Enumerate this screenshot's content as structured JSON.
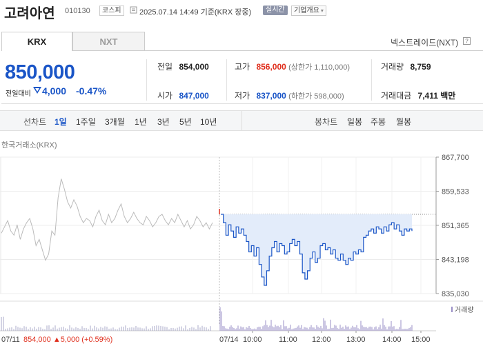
{
  "header": {
    "stock_name": "고려아연",
    "stock_code": "010130",
    "market": "코스피",
    "datetime": "2025.07.14 14:49 기준(KRX 장중)",
    "realtime": "실시간",
    "company_info": "기업개요"
  },
  "tabs": {
    "krx": "KRX",
    "nxt": "NXT",
    "nextrade": "넥스트레이드(NXT)",
    "help": "?"
  },
  "price": {
    "current": "850,000",
    "change_label": "전일대비",
    "change": "4,000",
    "change_pct": "-0.47%"
  },
  "stats": {
    "prev_close_label": "전일",
    "prev_close": "854,000",
    "high_label": "고가",
    "high": "856,000",
    "upper_limit": "(상한가 1,110,000)",
    "volume_label": "거래량",
    "volume": "8,759",
    "open_label": "시가",
    "open": "847,000",
    "low_label": "저가",
    "low": "837,000",
    "lower_limit": "(하한가 598,000)",
    "amount_label": "거래대금",
    "amount": "7,411",
    "amount_unit": "백만"
  },
  "periods": {
    "line_label": "선차트",
    "line_items": [
      "1일",
      "1주일",
      "3개월",
      "1년",
      "3년",
      "5년",
      "10년"
    ],
    "active": "1일",
    "candle_label": "봉차트",
    "candle_items": [
      "일봉",
      "주봉",
      "월봉"
    ]
  },
  "exchange_label": "한국거래소(KRX)",
  "colors": {
    "up": "#e0301e",
    "down": "#1a55c7",
    "area": "#e3ecfa",
    "prev_line": "#bbbbbb"
  },
  "chart_data": {
    "type": "line",
    "y_ticks": [
      "867,700",
      "859,533",
      "851,365",
      "843,198",
      "835,030"
    ],
    "ylim": [
      835030,
      867700
    ],
    "x_ticks": [
      "07/11",
      "07/14",
      "10:00",
      "11:00",
      "12:00",
      "13:00",
      "14:00",
      "15:00"
    ],
    "prev_close": 854000,
    "prev_day_footer": {
      "date": "07/11",
      "price": "854,000",
      "change": "▲5,000",
      "pct": "(+0.59%)"
    },
    "volume_legend": "거래량",
    "series": [
      {
        "values": [
          849500,
          851000,
          852500,
          850000,
          849000,
          851500,
          848000,
          850500,
          852000,
          853000,
          850500,
          846500,
          848000,
          845500,
          843000,
          844500,
          850000,
          849000,
          858000,
          862500,
          860000,
          857000,
          855500,
          857500,
          856000,
          853500,
          852000,
          853000,
          852500,
          851000,
          853500,
          855000,
          852500,
          851500,
          854000,
          852000,
          853000,
          855000,
          856500,
          853500,
          852000,
          853000,
          854500,
          853000,
          852000,
          851500,
          853500,
          852500,
          851000,
          852000,
          853500,
          854000,
          852500,
          851500,
          853000,
          852000,
          854000,
          852500,
          851000,
          852500,
          850500,
          851500,
          853500,
          852500,
          851000,
          852000,
          850500,
          852000
        ]
      },
      {
        "values": [
          854000,
          852000,
          849000,
          851500,
          850000,
          848500,
          851000,
          849500,
          850500,
          849000,
          847500,
          845000,
          846500,
          844000,
          846000,
          842000,
          839000,
          837000,
          840500,
          844000,
          846000,
          847500,
          845000,
          847000,
          846500,
          844500,
          845000,
          847000,
          848000,
          846500,
          847500,
          844500,
          840000,
          838500,
          840500,
          843500,
          845000,
          842500,
          843500,
          846500,
          847000,
          845500,
          846000,
          844500,
          845500,
          843500,
          843000,
          844500,
          843000,
          842000,
          843500,
          843000,
          845000,
          844500,
          845500,
          845000,
          848500,
          849000,
          850000,
          850500,
          849500,
          851000,
          850500,
          849500,
          851000,
          850000,
          851500,
          852000,
          850500,
          851500,
          850000,
          849000,
          850500,
          850000,
          850500,
          850000
        ]
      }
    ]
  }
}
